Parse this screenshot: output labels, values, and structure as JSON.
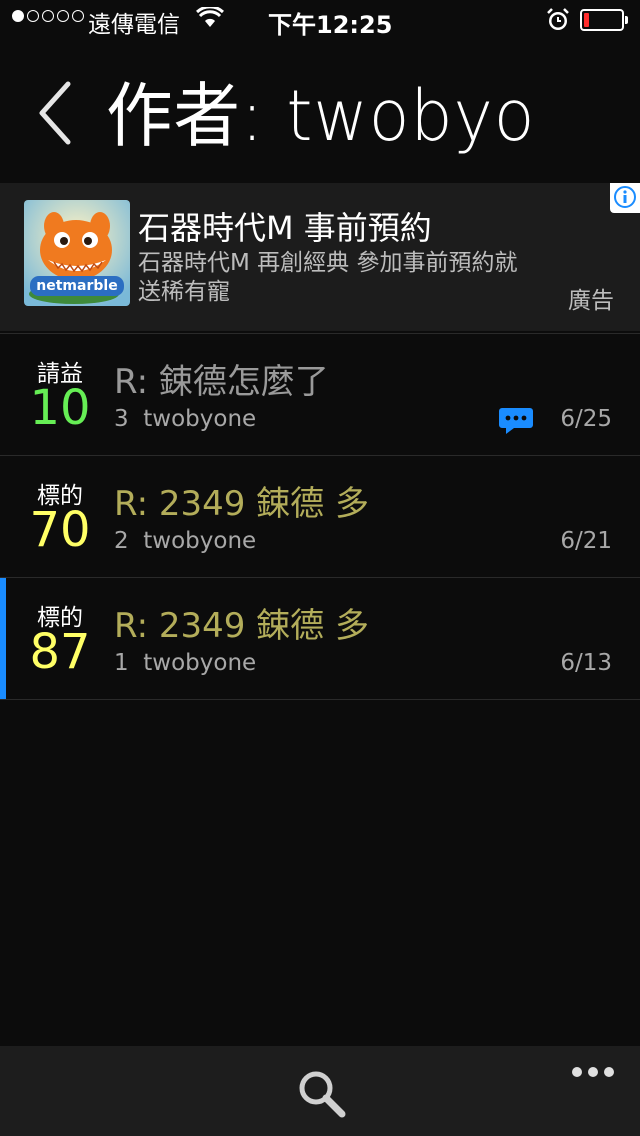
{
  "status_bar": {
    "carrier": "遠傳電信",
    "time": "下午12:25"
  },
  "header": {
    "title": "作者: twobyo",
    "back_icon": "chevron-left-icon"
  },
  "ad": {
    "title": "石器時代M 事前預約",
    "description": "石器時代M 再創經典 參加事前預約就送稀有寵",
    "tag": "廣告",
    "brand": "netmarble",
    "info_icon": "info-icon"
  },
  "colors": {
    "green": "#66ee55",
    "yellow": "#ffff66",
    "title_gray": "#9a9a9a",
    "title_olive": "#b3ad5a",
    "marker_blue": "#1a8cff",
    "comment_blue": "#1a8cff"
  },
  "posts": [
    {
      "category": "請益",
      "score": "10",
      "score_color": "#66ee55",
      "title": "R: 鋉德怎麼了",
      "title_color": "#9a9a9a",
      "meta": "3  twobyone",
      "date": "6/25",
      "has_comment_icon": true
    },
    {
      "category": "標的",
      "score": "70",
      "score_color": "#ffff66",
      "title": "R: 2349 鋉德 多",
      "title_color": "#b3ad5a",
      "meta": "2  twobyone",
      "date": "6/21",
      "has_comment_icon": false
    },
    {
      "category": "標的",
      "score": "87",
      "score_color": "#ffff66",
      "title": "R: 2349 鋉德 多",
      "title_color": "#b3ad5a",
      "meta": "1  twobyone",
      "date": "6/13",
      "has_comment_icon": false,
      "selected": true
    }
  ],
  "toolbar": {
    "search_icon": "search-icon",
    "more_icon": "more-icon"
  }
}
